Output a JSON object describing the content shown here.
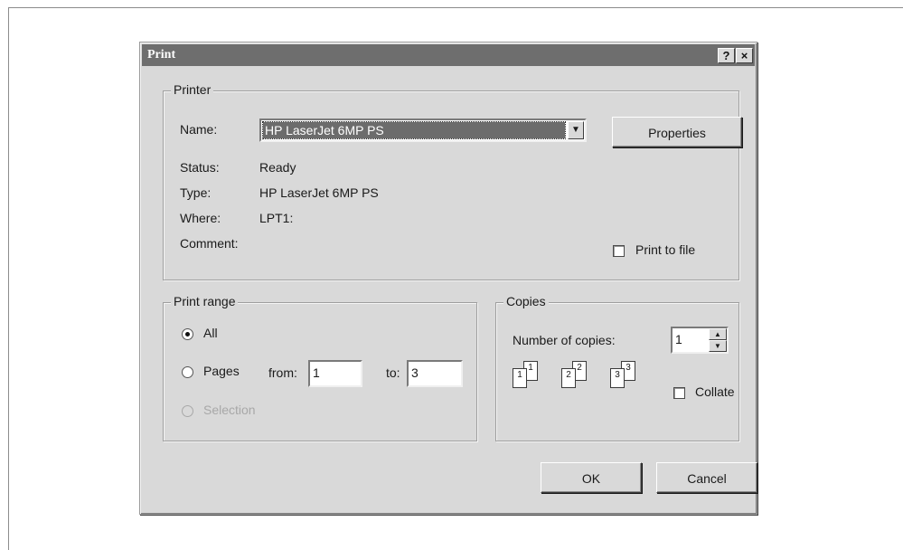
{
  "window": {
    "title": "Print",
    "help_glyph": "?",
    "close_glyph": "×"
  },
  "printer": {
    "group_label": "Printer",
    "name_label": "Name:",
    "name_value": "HP LaserJet 6MP PS",
    "properties_label": "Properties",
    "status_label": "Status:",
    "status_value": "Ready",
    "type_label": "Type:",
    "type_value": "HP LaserJet 6MP PS",
    "where_label": "Where:",
    "where_value": "LPT1:",
    "comment_label": "Comment:",
    "print_to_file_label": "Print to file",
    "print_to_file_checked": false
  },
  "print_range": {
    "group_label": "Print range",
    "all_label": "All",
    "pages_label": "Pages",
    "from_label": "from:",
    "from_value": "1",
    "to_label": "to:",
    "to_value": "3",
    "selection_label": "Selection",
    "selected": "All"
  },
  "copies": {
    "group_label": "Copies",
    "number_label": "Number of copies:",
    "number_value": "1",
    "collate_label": "Collate",
    "collate_checked": false,
    "collate_pages": [
      "1",
      "1",
      "2",
      "2",
      "3",
      "3"
    ]
  },
  "buttons": {
    "ok_label": "OK",
    "cancel_label": "Cancel"
  }
}
